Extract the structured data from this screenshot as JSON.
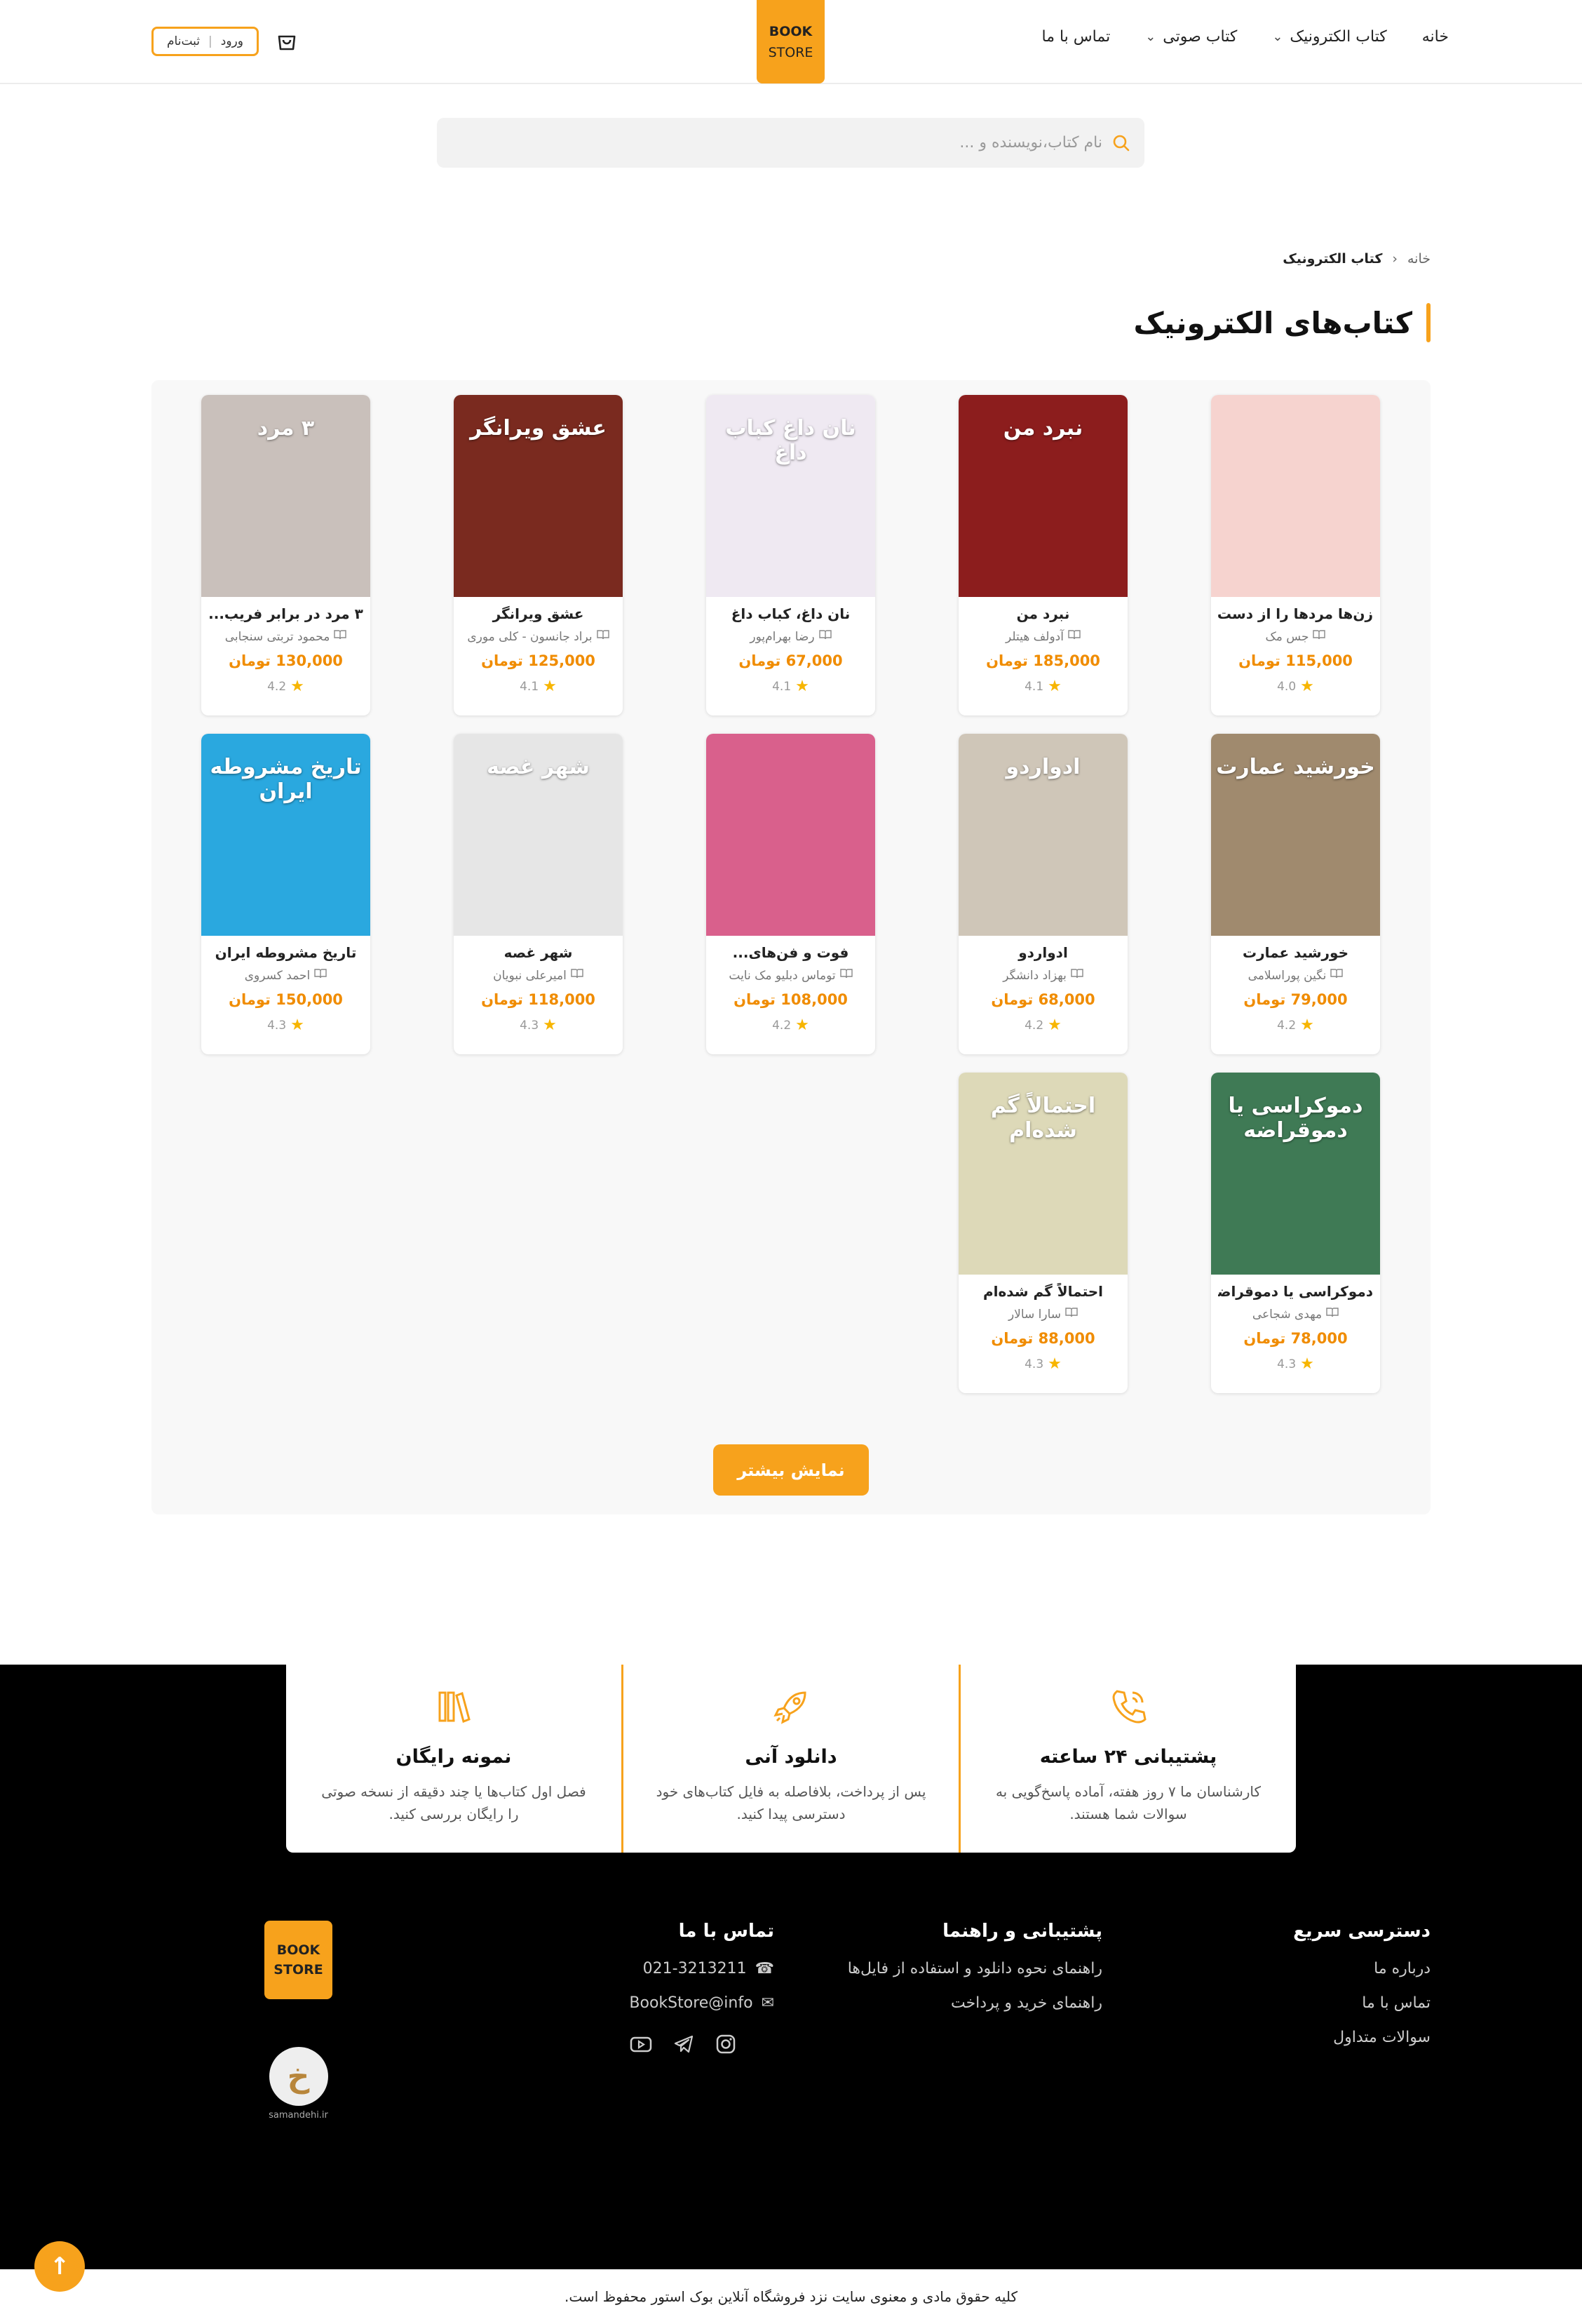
{
  "header": {
    "nav": [
      {
        "label": "خانه",
        "dropdown": false
      },
      {
        "label": "کتاب الکترونیک",
        "dropdown": true
      },
      {
        "label": "کتاب صوتی",
        "dropdown": true
      },
      {
        "label": "تماس با ما",
        "dropdown": false
      }
    ],
    "logo_line1": "BOOK",
    "logo_line2": "STORE",
    "login": "ورود",
    "auth_separator": "|",
    "register": "ثبت‌نام"
  },
  "search": {
    "placeholder": "نام کتاب،نویسنده و ..."
  },
  "breadcrumb": {
    "home": "خانه",
    "current": "کتاب الکترونیک"
  },
  "page_title": "کتاب‌های الکترونیک",
  "currency": "تومان",
  "books": [
    {
      "title": "زن‌ها مردها را از دست...",
      "author": "جس مک",
      "price": "115,000 تومان",
      "rating": "4.0",
      "cover_color": "#f6d3cf",
      "cover_text": ""
    },
    {
      "title": "نبرد من",
      "author": "آدولف هیتلر",
      "price": "185,000 تومان",
      "rating": "4.1",
      "cover_color": "#8c1d1d",
      "cover_text": "نبرد من"
    },
    {
      "title": "نان داغ، کباب داغ",
      "author": "رضا بهرام‌پور",
      "price": "67,000 تومان",
      "rating": "4.1",
      "cover_color": "#efe9f2",
      "cover_text": "نان داغ کباب داغ"
    },
    {
      "title": "عشق ویرانگر",
      "author": "براد جانسون - کلی موری",
      "price": "125,000 تومان",
      "rating": "4.1",
      "cover_color": "#7a2a1f",
      "cover_text": "عشق ویرانگر"
    },
    {
      "title": "۳ مرد در برابر فریب...",
      "author": "محمود تربتی سنجابی",
      "price": "130,000 تومان",
      "rating": "4.2",
      "cover_color": "#c9c0bb",
      "cover_text": "۳ مرد"
    },
    {
      "title": "خورشید عمارت",
      "author": "نگین پوراسلامی",
      "price": "79,000 تومان",
      "rating": "4.2",
      "cover_color": "#a08a6e",
      "cover_text": "خورشید عمارت"
    },
    {
      "title": "ادواردو",
      "author": "بهزاد دانشگر",
      "price": "68,000 تومان",
      "rating": "4.2",
      "cover_color": "#cfc6b8",
      "cover_text": "ادواردو"
    },
    {
      "title": "فوت و فن‌های...",
      "author": "توماس دبلیو مک نایت",
      "price": "108,000 تومان",
      "rating": "4.2",
      "cover_color": "#d9608c",
      "cover_text": ""
    },
    {
      "title": "شهر غصه",
      "author": "امیرعلی نبویان",
      "price": "118,000 تومان",
      "rating": "4.3",
      "cover_color": "#e6e6e6",
      "cover_text": "شهر غصه"
    },
    {
      "title": "تاریخ مشروطه ایران",
      "author": "احمد کسروی",
      "price": "150,000 تومان",
      "rating": "4.3",
      "cover_color": "#2aa8df",
      "cover_text": "تاریخ مشروطه ایران"
    },
    {
      "title": "دموکراسی یا دموقراضه",
      "author": "مهدی شجاعی",
      "price": "78,000 تومان",
      "rating": "4.3",
      "cover_color": "#3f7a55",
      "cover_text": "دموکراسی یا دموقراضه"
    },
    {
      "title": "احتمالاً گم شده‌ام",
      "author": "سارا سالار",
      "price": "88,000 تومان",
      "rating": "4.3",
      "cover_color": "#ddd9b8",
      "cover_text": "احتمالاً گم شده‌ام"
    }
  ],
  "more_button": "نمایش بیشتر",
  "features": [
    {
      "title": "نمونه رایگان",
      "text": "فصل اول کتاب‌ها یا چند دقیقه از نسخه صوتی را رایگان بررسی کنید.",
      "icon": "books-icon"
    },
    {
      "title": "دانلود آنی",
      "text": "پس از پرداخت، بلافاصله به فایل کتاب‌های خود دسترسی پیدا کنید.",
      "icon": "rocket-icon"
    },
    {
      "title": "پشتیبانی ۲۴ ساعته",
      "text": "کارشناسان ما ۷ روز هفته، آماده پاسخ‌گویی به سوالات شما هستند.",
      "icon": "phone-icon"
    }
  ],
  "footer": {
    "quick_title": "دسترسی سریع",
    "quick_links": [
      "درباره ما",
      "تماس با ما",
      "سوالات متداول"
    ],
    "support_title": "پشتیبانی و راهنما",
    "support_links": [
      "راهنمای نحوه دانلود و استفاده از فایل‌ها",
      "راهنمای خرید و پرداخت"
    ],
    "contact_title": "تماس با ما",
    "phone": "021-3213211",
    "email": "BookStore@info",
    "logo_line1": "BOOK",
    "logo_line2": "STORE",
    "samandehi_text": "samandehi.ir"
  },
  "copyright": "کلیه حقوق مادی و معنوی سایت نزد فروشگاه آنلاین بوک استور محفوظ است.",
  "colors": {
    "accent": "#f7a21c",
    "price": "#f08c00",
    "footer_bg": "#000000"
  }
}
